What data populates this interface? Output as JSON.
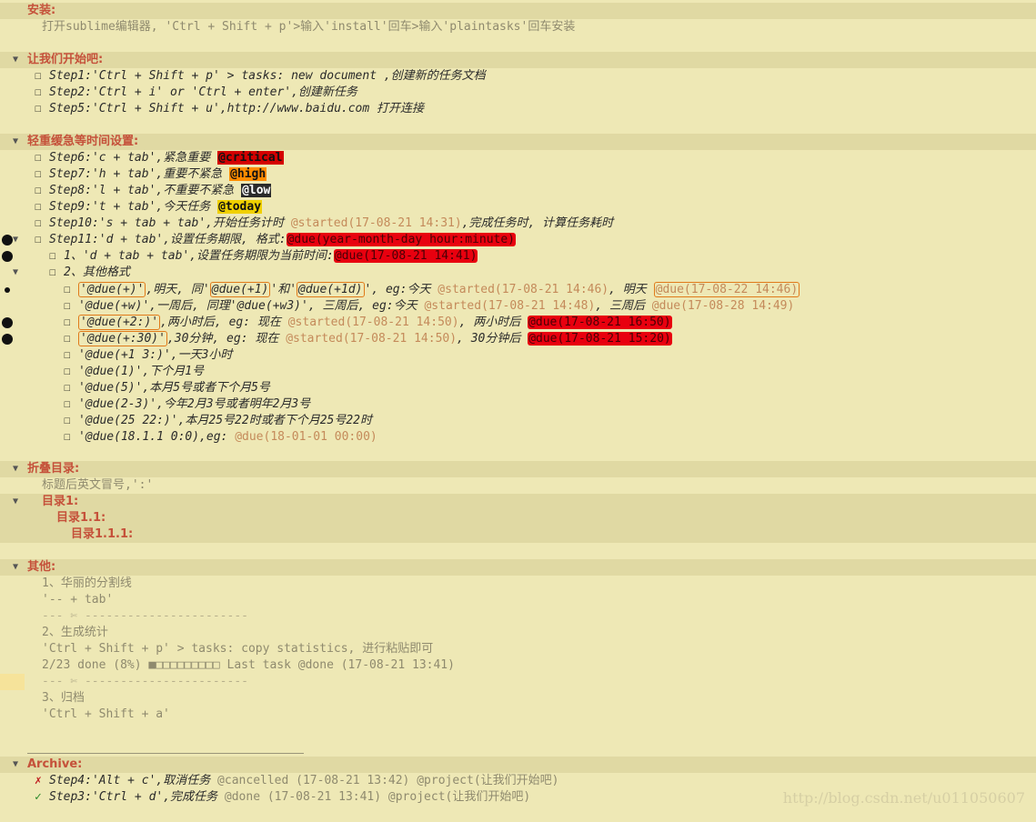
{
  "sections": {
    "install": {
      "title": "安装:",
      "text": "打开sublime编辑器, 'Ctrl + Shift + p'>输入'install'回车>输入'plaintasks'回车安装"
    },
    "start": {
      "title": "让我们开始吧:",
      "items": [
        "Step1:'Ctrl + Shift + p' > tasks: new document ,创建新的任务文档",
        "Step2:'Ctrl + i' or 'Ctrl + enter',创建新任务",
        "Step5:'Ctrl + Shift + u',http://www.baidu.com 打开连接"
      ]
    },
    "priority": {
      "title": "轻重缓急等时间设置:",
      "s6": "Step6:'c + tab',紧急重要 ",
      "s6_tag": "@critical",
      "s7": "Step7:'h + tab',重要不紧急 ",
      "s7_tag": "@high",
      "s8": "Step8:'l + tab',不重要不紧急 ",
      "s8_tag": "@low",
      "s9": "Step9:'t + tab',今天任务 ",
      "s9_tag": "@today",
      "s10": "Step10:'s + tab + tab',开始任务计时 ",
      "s10_tag": "@started(17-08-21 14:31)",
      "s10_end": ",完成任务时, 计算任务耗时",
      "s11": "Step11:'d + tab',设置任务期限, 格式:",
      "s11_tag": "@due(year-month-day hour:minute)",
      "sub1": "1、'd + tab + tab',设置任务期限为当前时间:",
      "sub1_tag": "@due(17-08-21 14:41)",
      "sub2": "2、其他格式",
      "f1_a": "'@due(+)'",
      "f1_b": ",明天, 同'",
      "f1_c": "@due(+1)",
      "f1_d": "'和'",
      "f1_e": "@due(+1d)",
      "f1_f": "', eg:今天 ",
      "f1_g": "@started(17-08-21 14:46)",
      "f1_h": ", 明天 ",
      "f1_i": "@due(17-08-22 14:46)",
      "f2_a": "'@due(+w)',一周后, 同理'@due(+w3)', 三周后, eg:今天 ",
      "f2_b": "@started(17-08-21 14:48)",
      "f2_c": ", 三周后 ",
      "f2_d": "@due(17-08-28 14:49)",
      "f3_a": "'@due(+2:)'",
      "f3_b": ",两小时后, eg: 现在 ",
      "f3_c": "@started(17-08-21 14:50)",
      "f3_d": ", 两小时后 ",
      "f3_e": "@due(17-08-21 16:50)",
      "f4_a": "'@due(+:30)'",
      "f4_b": ",30分钟, eg: 现在 ",
      "f4_c": "@started(17-08-21 14:50)",
      "f4_d": ", 30分钟后 ",
      "f4_e": "@due(17-08-21 15:20)",
      "f5": "'@due(+1 3:)',一天3小时",
      "f6": "'@due(1)',下个月1号",
      "f7": "'@due(5)',本月5号或者下个月5号",
      "f8": "'@due(2-3)',今年2月3号或者明年2月3号",
      "f9": "'@due(25 22:)',本月25号22时或者下个月25号22时",
      "f10_a": "'@due(18.1.1 0:0),eg: ",
      "f10_b": "@due(18-01-01 00:00)"
    },
    "fold": {
      "title": "折叠目录:",
      "text": "标题后英文冒号,':'",
      "l1": "目录1:",
      "l2": "目录1.1:",
      "l3": "目录1.1.1:"
    },
    "other": {
      "title": "其他:",
      "lines": [
        "1、华丽的分割线",
        "'-- + tab'",
        "--- ✄ -----------------------",
        "2、生成统计",
        "'Ctrl + Shift + p' > tasks: copy statistics, 进行粘贴即可",
        "2/23 done (8%) ■□□□□□□□□□ Last task @done (17-08-21 13:41)",
        "--- ✄ -----------------------",
        "3、归档",
        "'Ctrl + Shift + a'"
      ]
    },
    "archive": {
      "title": "Archive:",
      "i1_mark": "✗",
      "i1_a": "Step4:'Alt + c',取消任务",
      "i1_b": " @cancelled (17-08-21 13:42) @project(让我们开始吧)",
      "i2_mark": "✓",
      "i2_a": "Step3:'Ctrl + d',完成任务",
      "i2_b": " @done (17-08-21 13:41) @project(让我们开始吧)"
    }
  },
  "ui": {
    "fold_triangle": "▼",
    "checkbox": "☐",
    "watermark": "http://blog.csdn.net/u011050607"
  }
}
